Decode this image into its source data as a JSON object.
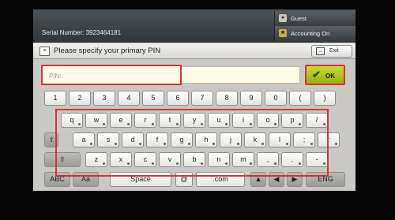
{
  "status": {
    "serial_number": "Serial Number: 3923464181",
    "user": "Guest",
    "accounting": "Accounting On"
  },
  "header": {
    "title": "Please specify your primary PIN",
    "exit_label": "Exit"
  },
  "pin": {
    "placeholder": "PIN:",
    "value": ""
  },
  "ok_label": "OK",
  "keyboard": {
    "number_row": [
      "1",
      "2",
      "3",
      "4",
      "5",
      "6",
      "7",
      "8",
      "9",
      "0",
      "(",
      ")"
    ],
    "row_q": [
      "q",
      "w",
      "e",
      "r",
      "t",
      "y",
      "u",
      "i",
      "o",
      "p",
      "/"
    ],
    "row_a": [
      "a",
      "s",
      "d",
      "f",
      "g",
      "h",
      "j",
      "k",
      "l",
      ";",
      ":"
    ],
    "row_z": [
      "z",
      "x",
      "c",
      "v",
      "b",
      "n",
      "m",
      ",",
      ".",
      "-"
    ],
    "space_label": "Space",
    "at_label": "@",
    "dotcom_label": ".com",
    "abc_label": "ABC",
    "aa_label": "Aa",
    "lang_label": "ENG"
  },
  "colors": {
    "highlight": "#d8333a",
    "ok_green": "#a8c420"
  }
}
